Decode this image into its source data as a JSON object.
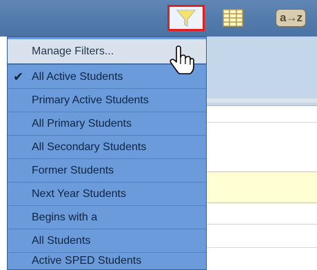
{
  "toolbar": {
    "filter_icon": "funnel-icon",
    "grid_icon": "grid-icon",
    "sort_icon": "a-z-sort-icon",
    "sort_label": "a→z"
  },
  "menu": {
    "header": "Manage Filters...",
    "items": [
      {
        "label": "All Active Students",
        "checked": true
      },
      {
        "label": "Primary Active Students",
        "checked": false
      },
      {
        "label": "All Primary Students",
        "checked": false
      },
      {
        "label": "All Secondary Students",
        "checked": false
      },
      {
        "label": "Former Students",
        "checked": false
      },
      {
        "label": "Next Year Students",
        "checked": false
      },
      {
        "label": "Begins with a",
        "checked": false
      },
      {
        "label": "All Students",
        "checked": false
      },
      {
        "label": "Active SPED Students",
        "checked": false
      }
    ],
    "check_glyph": "✔"
  },
  "colors": {
    "toolbar": "#4a72a3",
    "menu": "#6b9bdb",
    "highlight_border": "#e02020"
  }
}
